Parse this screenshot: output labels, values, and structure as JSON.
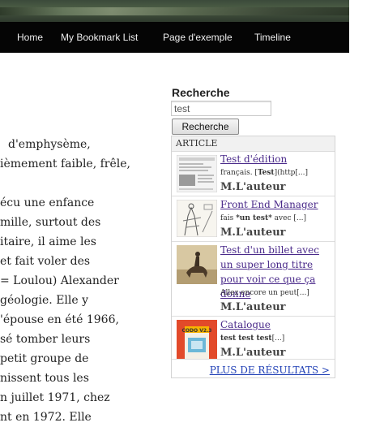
{
  "nav": {
    "items": [
      "Home",
      "My Bookmark List",
      "Page d'exemple",
      "Timeline"
    ]
  },
  "article": {
    "lines": [
      "d'emphysème,",
      "ièmement faible, frêle,",
      "",
      "écu une enfance",
      "mille, surtout des",
      "itaire, il aime les",
      "et fait voler des",
      "= Loulou) Alexander",
      "géologie. Elle y",
      "'épouse en été 1966,",
      "sé tomber leurs",
      "petit groupe de",
      "nissent tous les",
      "n juillet 1971, chez",
      "nt en 1972. Elle"
    ]
  },
  "search": {
    "heading": "Recherche",
    "value": "test",
    "button_label": "Recherche",
    "results_header": "ARTICLE",
    "results": [
      {
        "title": "Test d'édition",
        "excerpt_pre": "français. [",
        "excerpt_bold": "Test",
        "excerpt_post": "](http[...]",
        "author": "M.L'auteur"
      },
      {
        "title": "Front End Manager",
        "excerpt_pre": "fais ",
        "excerpt_bold": "*un test*",
        "excerpt_post": " avec [...]",
        "author": "M.L'auteur"
      },
      {
        "title": "Test d'un billet avec un super long titre pour voir ce que ça donne",
        "excerpt_pre": "Allez encore un peut[...]",
        "excerpt_bold": "",
        "excerpt_post": "",
        "author": "M.L'auteur"
      },
      {
        "title": "Catalogue",
        "excerpt_pre": "",
        "excerpt_bold": "test test test",
        "excerpt_post": "[...]",
        "author": "M.L'auteur",
        "thumb_text": "CODO V2.3"
      }
    ],
    "more_label": "PLUS DE RÉSULTATS >"
  }
}
